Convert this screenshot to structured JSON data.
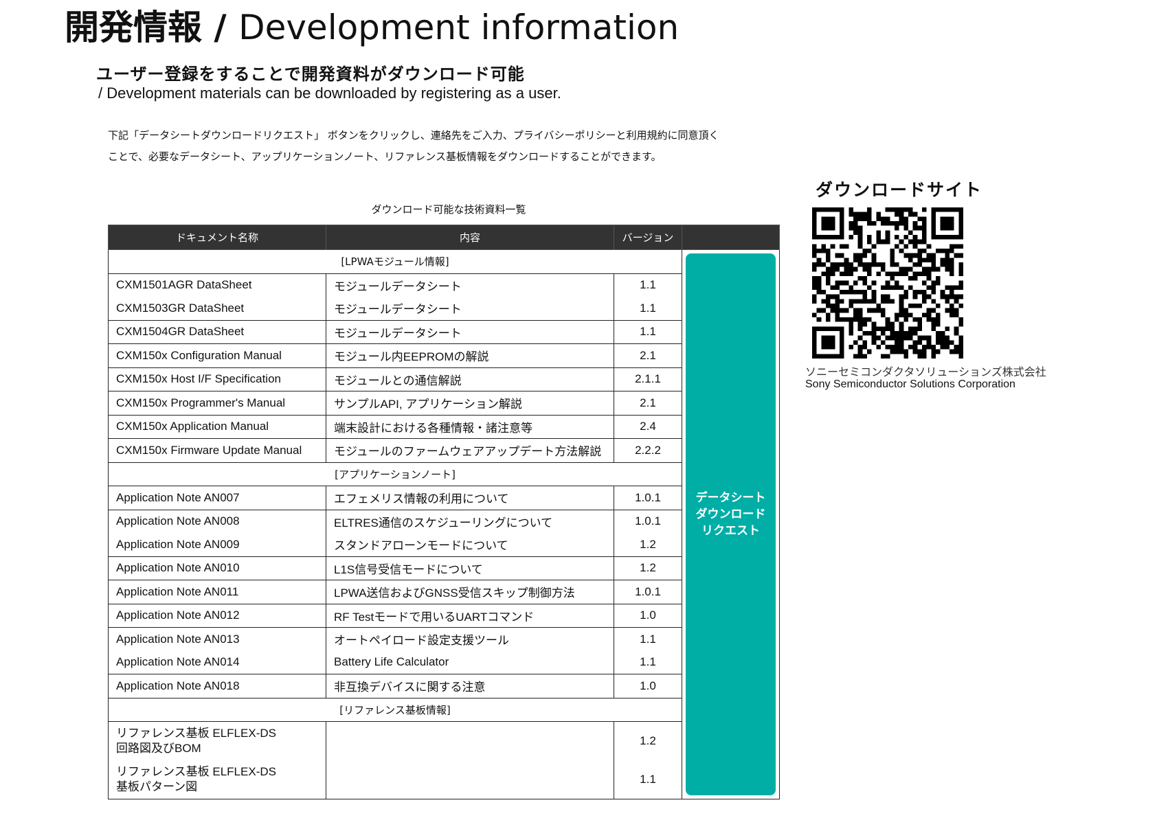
{
  "header": {
    "title_jp": "開発情報",
    "title_sep": " / ",
    "title_en": "Development information",
    "subtitle_jp": "ユーザー登録をすることで開発資料がダウンロード可能",
    "subtitle_en": "/ Development materials can be downloaded by registering as a user."
  },
  "description": {
    "line1": "下記「データシートダウンロードリクエスト」 ボタンをクリックし、連絡先をご入力、プライバシーポリシーと利用規約に同意頂く",
    "line2": "ことで、必要なデータシート、アップリケーションノート、リファレンス基板情報をダウンロードすることができます。"
  },
  "table": {
    "caption": "ダウンロード可能な技術資料一覧",
    "headers": [
      "ドキュメント名称",
      "内容",
      "バージョン"
    ],
    "sections": [
      {
        "label": "[LPWAモジュール情報]",
        "rows": [
          {
            "name": "CXM1501AGR DataSheet",
            "content": "モジュールデータシート",
            "version": "1.1"
          },
          {
            "name": "CXM1503GR DataSheet",
            "content": "モジュールデータシート",
            "version": "1.1"
          },
          {
            "name": "CXM1504GR DataSheet",
            "content": "モジュールデータシート",
            "version": "1.1"
          },
          {
            "name": "CXM150x Configuration Manual",
            "content": "モジュール内EEPROMの解説",
            "version": "2.1"
          },
          {
            "name": "CXM150x Host I/F Specification",
            "content": "モジュールとの通信解説",
            "version": "2.1.1"
          },
          {
            "name": "CXM150x Programmer's Manual",
            "content": "サンプルAPI, アプリケーション解説",
            "version": "2.1"
          },
          {
            "name": "CXM150x Application Manual",
            "content": "端末設計における各種情報・諸注意等",
            "version": "2.4"
          },
          {
            "name": "CXM150x Firmware Update Manual",
            "content": "モジュールのファームウェアアップデート方法解説",
            "version": "2.2.2"
          }
        ]
      },
      {
        "label": "[アプリケーションノート]",
        "rows": [
          {
            "name": "Application Note AN007",
            "content": "エフェメリス情報の利用について",
            "version": "1.0.1"
          },
          {
            "name": "Application Note AN008",
            "content": "ELTRES通信のスケジューリングについて",
            "version": "1.0.1"
          },
          {
            "name": "Application Note AN009",
            "content": "スタンドアローンモードについて",
            "version": "1.2"
          },
          {
            "name": "Application Note AN010",
            "content": "L1S信号受信モードについて",
            "version": "1.2"
          },
          {
            "name": "Application Note AN011",
            "content": "LPWA送信およびGNSS受信スキップ制御方法",
            "version": "1.0.1"
          },
          {
            "name": "Application Note AN012",
            "content": "RF Testモードで用いるUARTコマンド",
            "version": "1.0"
          },
          {
            "name": "Application Note AN013",
            "content": "オートペイロード設定支援ツール",
            "version": "1.1"
          },
          {
            "name": "Application Note AN014",
            "content": "Battery Life Calculator",
            "version": "1.1"
          },
          {
            "name": "Application Note AN018",
            "content": "非互換デバイスに関する注意",
            "version": "1.0"
          }
        ]
      },
      {
        "label": "[リファレンス基板情報]",
        "rows": [
          {
            "name": "リファレンス基板 ELFLEX-DS\n回路図及びBOM",
            "content": "",
            "version": "1.2"
          },
          {
            "name": "リファレンス基板 ELFLEX-DS\n基板パターン図",
            "content": "",
            "version": "1.1"
          }
        ]
      }
    ],
    "button_label": "データシート\nダウンロード\nリクエスト"
  },
  "download_site": {
    "title": "ダウンロードサイト",
    "company_jp": "ソニーセミコンダクタソリューションズ株式会社",
    "company_en": "Sony Semiconductor Solutions Corporation"
  },
  "colors": {
    "header_bg": "#333333",
    "button_bg": "#00aea6"
  }
}
